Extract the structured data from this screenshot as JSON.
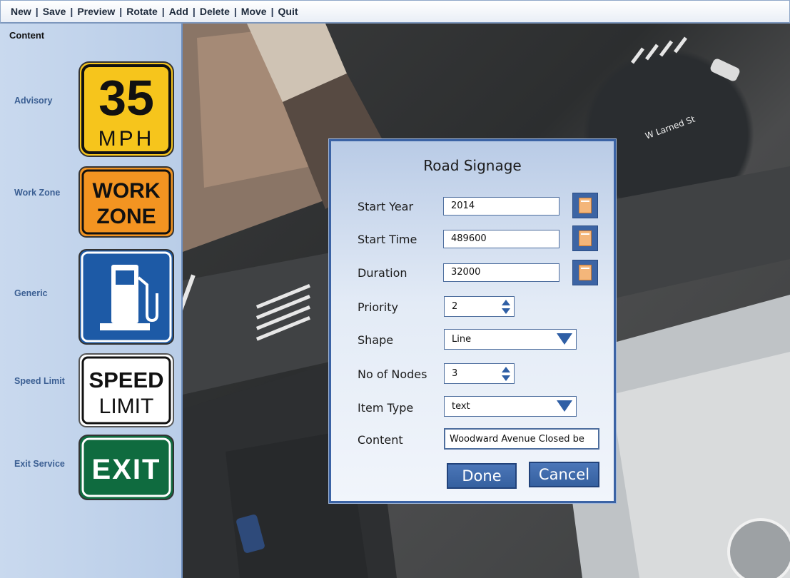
{
  "menu": {
    "items": [
      "New",
      "Save",
      "Preview",
      "Rotate",
      "Add",
      "Delete",
      "Move",
      "Quit"
    ],
    "separator": "|"
  },
  "sidebar": {
    "heading": "Content",
    "categories": [
      {
        "label": "Advisory",
        "sign": {
          "line1": "35",
          "line2": "MPH"
        }
      },
      {
        "label": "Work Zone",
        "sign": {
          "line1": "WORK",
          "line2": "ZONE"
        }
      },
      {
        "label": "Generic",
        "sign": {
          "icon": "fuel-pump-icon"
        }
      },
      {
        "label": "Speed Limit",
        "sign": {
          "line1": "SPEED",
          "line2": "LIMIT"
        }
      },
      {
        "label": "Exit Service",
        "sign": {
          "line1": "EXIT"
        }
      }
    ]
  },
  "map": {
    "street_label": "W Larned St"
  },
  "dialog": {
    "title": "Road Signage",
    "fields": {
      "start_year": {
        "label": "Start Year",
        "value": "2014"
      },
      "start_time": {
        "label": "Start Time",
        "value": "489600"
      },
      "duration": {
        "label": "Duration",
        "value": "32000"
      },
      "priority": {
        "label": "Priority",
        "value": "2"
      },
      "shape": {
        "label": "Shape",
        "value": "Line"
      },
      "no_of_nodes": {
        "label": "No of Nodes",
        "value": "3"
      },
      "item_type": {
        "label": "Item Type",
        "value": "text"
      },
      "content": {
        "label": "Content",
        "value": "Woodward Avenue Closed be"
      }
    },
    "done_label": "Done",
    "cancel_label": "Cancel"
  },
  "colors": {
    "accent": "#3c64a4",
    "advisory_sign": "#f6c51c",
    "workzone_sign": "#f39421",
    "generic_sign": "#1d5aa6",
    "exit_sign": "#0f6b3f"
  }
}
